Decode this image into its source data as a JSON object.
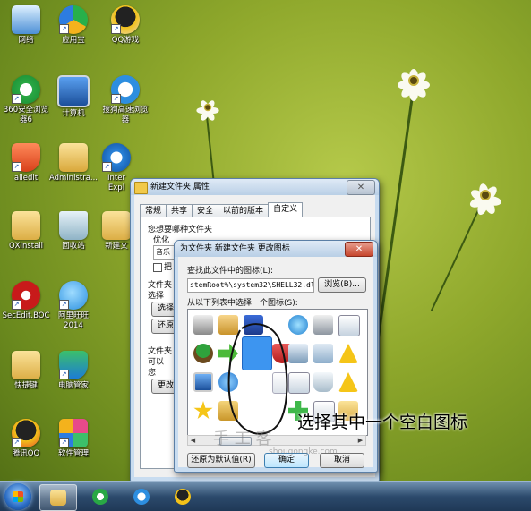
{
  "desktop": {
    "icons": [
      {
        "label": "网络"
      },
      {
        "label": "应用宝"
      },
      {
        "label": "QQ游戏"
      },
      {
        "label": "360安全浏览器6"
      },
      {
        "label": "计算机"
      },
      {
        "label": "搜狗高速浏览器"
      },
      {
        "label": "aliedit"
      },
      {
        "label": "Administra..."
      },
      {
        "label": "Inter Expl"
      },
      {
        "label": "QXInstall"
      },
      {
        "label": "回收站"
      },
      {
        "label": "新建文"
      },
      {
        "label": "SecEdit.BOC"
      },
      {
        "label": "阿里旺旺 2014"
      },
      {
        "label": "快捷键"
      },
      {
        "label": "电脑管家"
      },
      {
        "label": "腾讯QQ"
      },
      {
        "label": "软件管理"
      }
    ]
  },
  "properties_window": {
    "title": "新建文件夹 属性",
    "tabs": [
      "常规",
      "共享",
      "安全",
      "以前的版本",
      "自定义"
    ],
    "selected_tab": "自定义",
    "question": "您想要哪种文件夹",
    "optimize_label": "优化",
    "combo_value": "音乐",
    "checkbox_label": "把",
    "folder_pictures_label": "文件夹",
    "select_label": "选择",
    "choose_button": "选择",
    "restore_button": "还原",
    "folder_icons_label": "文件夹",
    "can_label": "可以",
    "no_label": "您",
    "change_button": "更改"
  },
  "change_icon_dialog": {
    "title": "为文件夹 新建文件夹 更改图标",
    "find_label": "查找此文件中的图标(L):",
    "path_value": "stemRoot%\\system32\\SHELL32.dll",
    "browse_button": "浏览(B)...",
    "select_label": "从以下列表中选择一个图标(S):",
    "restore_default_button": "还原为默认值(R)",
    "ok_button": "确定",
    "cancel_button": "取消"
  },
  "annotation": {
    "caption": "选择其中一个空白图标",
    "watermark": "手 工 客",
    "watermark_url": "shougongke.com"
  },
  "colors": {
    "selected_icon": "#3d95f0",
    "annotation_circle": "#111111"
  },
  "taskbar": {
    "items": [
      "start-button",
      "explorer-icon",
      "360-browser-icon",
      "sogou-browser-icon",
      "qq-game-icon"
    ]
  }
}
